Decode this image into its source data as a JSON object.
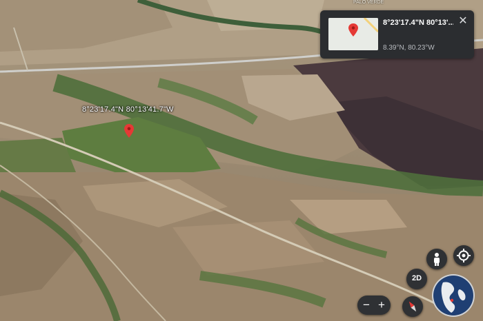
{
  "map": {
    "view": "3D satellite imagery",
    "pin_label": "8°23'17.4\"N 80°13'41.7\"W",
    "place_label": "PALO VERDE"
  },
  "info_card": {
    "title": "8°23'17.4\"N 80°13'...",
    "subtitle": "8.39°N, 80.23°W",
    "close_icon": "close-icon"
  },
  "controls": {
    "street_view_icon": "pegman-icon",
    "my_location_icon": "my-location-icon",
    "toggle_2d_label": "2D",
    "zoom_out_label": "−",
    "zoom_in_label": "+",
    "compass_icon": "compass-icon",
    "globe_icon": "globe-icon"
  },
  "colors": {
    "pin": "#e53935",
    "card_bg": "#2b2d30",
    "control_bg": "#2f3134"
  }
}
